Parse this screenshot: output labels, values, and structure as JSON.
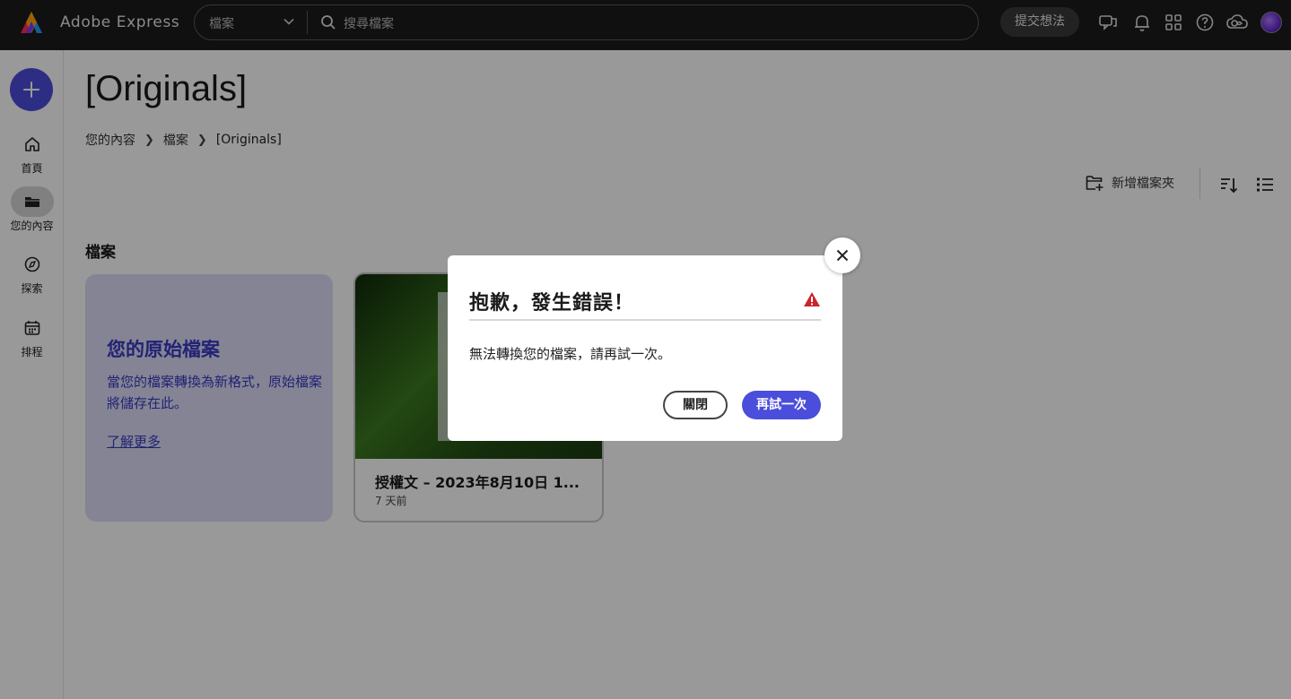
{
  "header": {
    "app_title": "Adobe Express",
    "search_scope": "檔案",
    "search_placeholder": "搜尋檔案",
    "feedback_label": "提交想法",
    "icons": [
      "chat-icon",
      "bell-icon",
      "apps-grid-icon",
      "help-icon",
      "creative-cloud-icon",
      "avatar"
    ]
  },
  "rail": {
    "create_icon": "plus-icon",
    "items": [
      {
        "label": "首頁",
        "icon": "home-icon",
        "active": false
      },
      {
        "label": "您的內容",
        "icon": "folder-icon",
        "active": true
      },
      {
        "label": "探索",
        "icon": "compass-icon",
        "active": false
      },
      {
        "label": "排程",
        "icon": "calendar-icon",
        "active": false
      }
    ]
  },
  "main": {
    "title": "[Originals]",
    "breadcrumb": [
      "您的內容",
      "檔案",
      "[Originals]"
    ],
    "new_folder_label": "新增檔案夾",
    "section_title": "檔案",
    "originals_card": {
      "title": "您的原始檔案",
      "description": "當您的檔案轉換為新格式，原始檔案將儲存在此。",
      "link": "了解更多"
    },
    "file_card": {
      "name": "授權文 – 2023年8月10日 1...",
      "time": "7 天前"
    }
  },
  "dialog": {
    "title": "抱歉，發生錯誤！",
    "message": "無法轉換您的檔案，請再試一次。",
    "close_label": "關閉",
    "retry_label": "再試一次",
    "warning_color": "#c9252d",
    "accent_color": "#4b4ddb"
  }
}
